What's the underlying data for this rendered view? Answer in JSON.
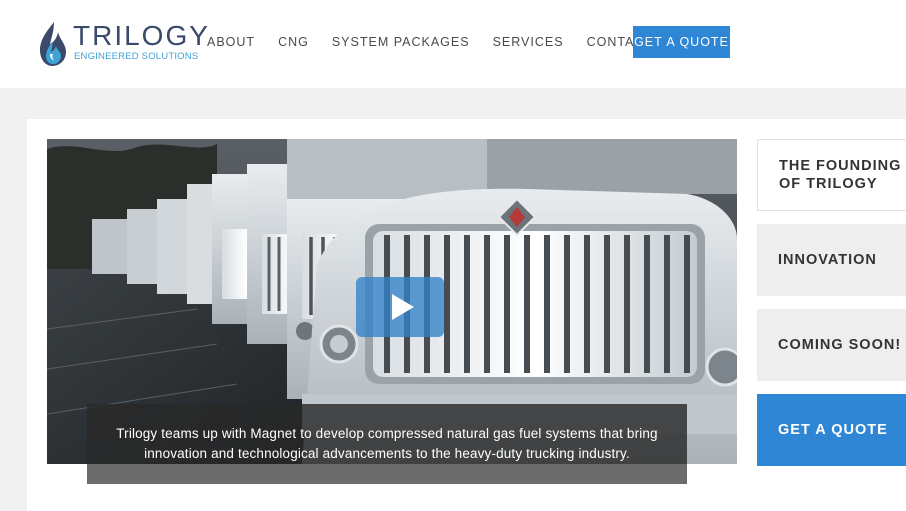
{
  "brand": {
    "name": "TRILOGY",
    "tagline": "ENGINEERED SOLUTIONS"
  },
  "nav": {
    "items": [
      {
        "label": "ABOUT"
      },
      {
        "label": "CNG"
      },
      {
        "label": "SYSTEM PACKAGES"
      },
      {
        "label": "SERVICES"
      },
      {
        "label": "CONTACT US"
      }
    ],
    "cta_label": "GET A QUOTE"
  },
  "video": {
    "caption_line1": "Trilogy teams up with Magnet to develop compressed natural gas fuel systems that bring",
    "caption_line2": "innovation and technological advancements to the heavy-duty trucking industry."
  },
  "side_tabs": [
    {
      "label_line1": "THE FOUNDING",
      "label_line2": "OF TRILOGY"
    },
    {
      "label_line1": "INNOVATION"
    },
    {
      "label_line1": "COMING SOON!"
    },
    {
      "label_line1": "GET A QUOTE"
    }
  ],
  "colors": {
    "accent": "#2f86d4",
    "logo_text": "#3b4a6b",
    "logo_sub": "#3fa3d6"
  },
  "icons": {
    "logo": "flame-drop-icon",
    "play": "play-icon"
  }
}
